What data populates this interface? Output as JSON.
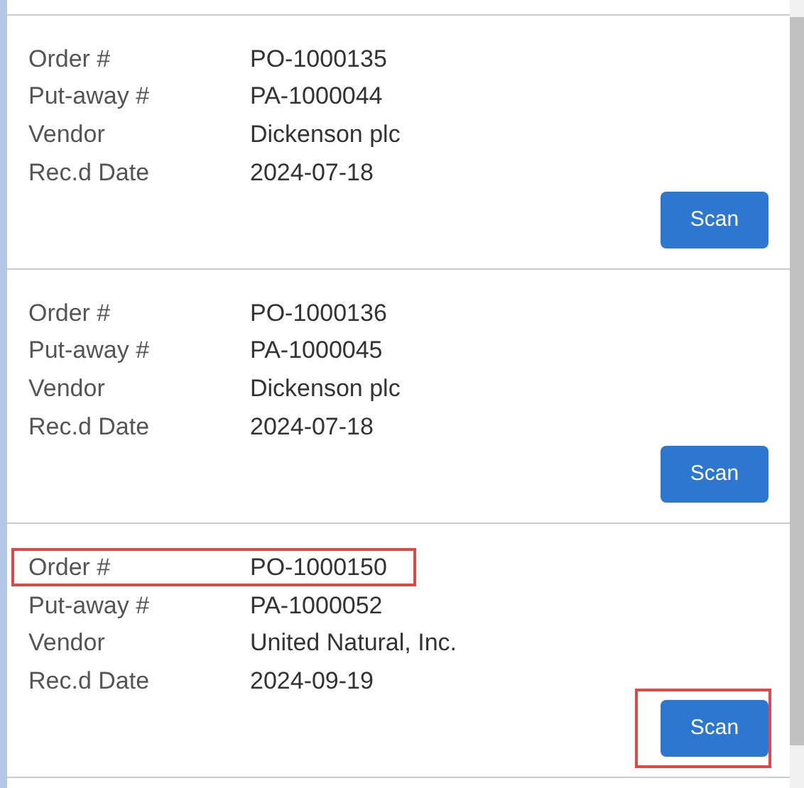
{
  "orders": [
    {
      "fields": [
        {
          "label": "Order #",
          "value": "PO-1000135",
          "highlighted": false
        },
        {
          "label": "Put-away #",
          "value": "PA-1000044",
          "highlighted": false
        },
        {
          "label": "Vendor",
          "value": "Dickenson plc",
          "highlighted": false
        },
        {
          "label": "Rec.d Date",
          "value": "2024-07-18",
          "highlighted": false
        }
      ],
      "button": "Scan",
      "button_highlighted": false
    },
    {
      "fields": [
        {
          "label": "Order #",
          "value": "PO-1000136",
          "highlighted": false
        },
        {
          "label": "Put-away #",
          "value": "PA-1000045",
          "highlighted": false
        },
        {
          "label": "Vendor",
          "value": "Dickenson plc",
          "highlighted": false
        },
        {
          "label": "Rec.d Date",
          "value": "2024-07-18",
          "highlighted": false
        }
      ],
      "button": "Scan",
      "button_highlighted": false
    },
    {
      "fields": [
        {
          "label": "Order #",
          "value": "PO-1000150",
          "highlighted": true
        },
        {
          "label": "Put-away #",
          "value": "PA-1000052",
          "highlighted": false
        },
        {
          "label": "Vendor",
          "value": "United Natural, Inc.",
          "highlighted": false
        },
        {
          "label": "Rec.d Date",
          "value": "2024-09-19",
          "highlighted": false
        }
      ],
      "button": "Scan",
      "button_highlighted": true
    }
  ]
}
